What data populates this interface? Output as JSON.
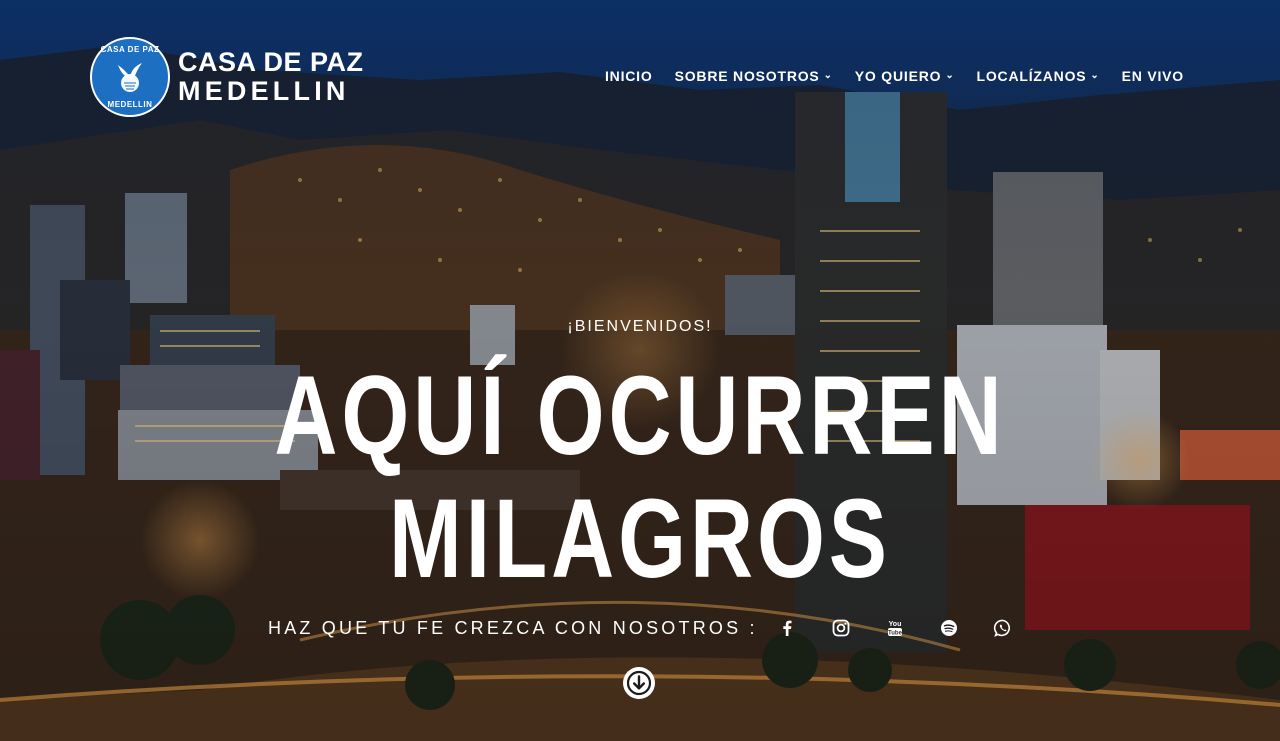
{
  "brand": {
    "badge_top": "CASA DE PAZ",
    "badge_bottom": "MEDELLIN",
    "line1": "CASA DE PAZ",
    "line2": "MEDELLIN",
    "badge_color": "#1d6fc2"
  },
  "nav": {
    "items": [
      {
        "label": "INICIO",
        "dropdown": false
      },
      {
        "label": "SOBRE NOSOTROS",
        "dropdown": true
      },
      {
        "label": "YO QUIERO",
        "dropdown": true
      },
      {
        "label": "LOCALÍZANOS",
        "dropdown": true
      },
      {
        "label": "EN VIVO",
        "dropdown": false
      }
    ]
  },
  "hero": {
    "welcome": "¡BIENVENIDOS!",
    "headline_line1": "AQUÍ OCURREN",
    "headline_line2": "MILAGROS",
    "tagline": "HAZ QUE TU FE CREZCA CON NOSOTROS :"
  },
  "socials": [
    {
      "icon": "facebook-icon"
    },
    {
      "icon": "instagram-icon"
    },
    {
      "icon": "youtube-icon"
    },
    {
      "icon": "spotify-icon"
    },
    {
      "icon": "whatsapp-icon"
    }
  ],
  "colors": {
    "text": "#ffffff",
    "sky": "#0d2a5a"
  }
}
